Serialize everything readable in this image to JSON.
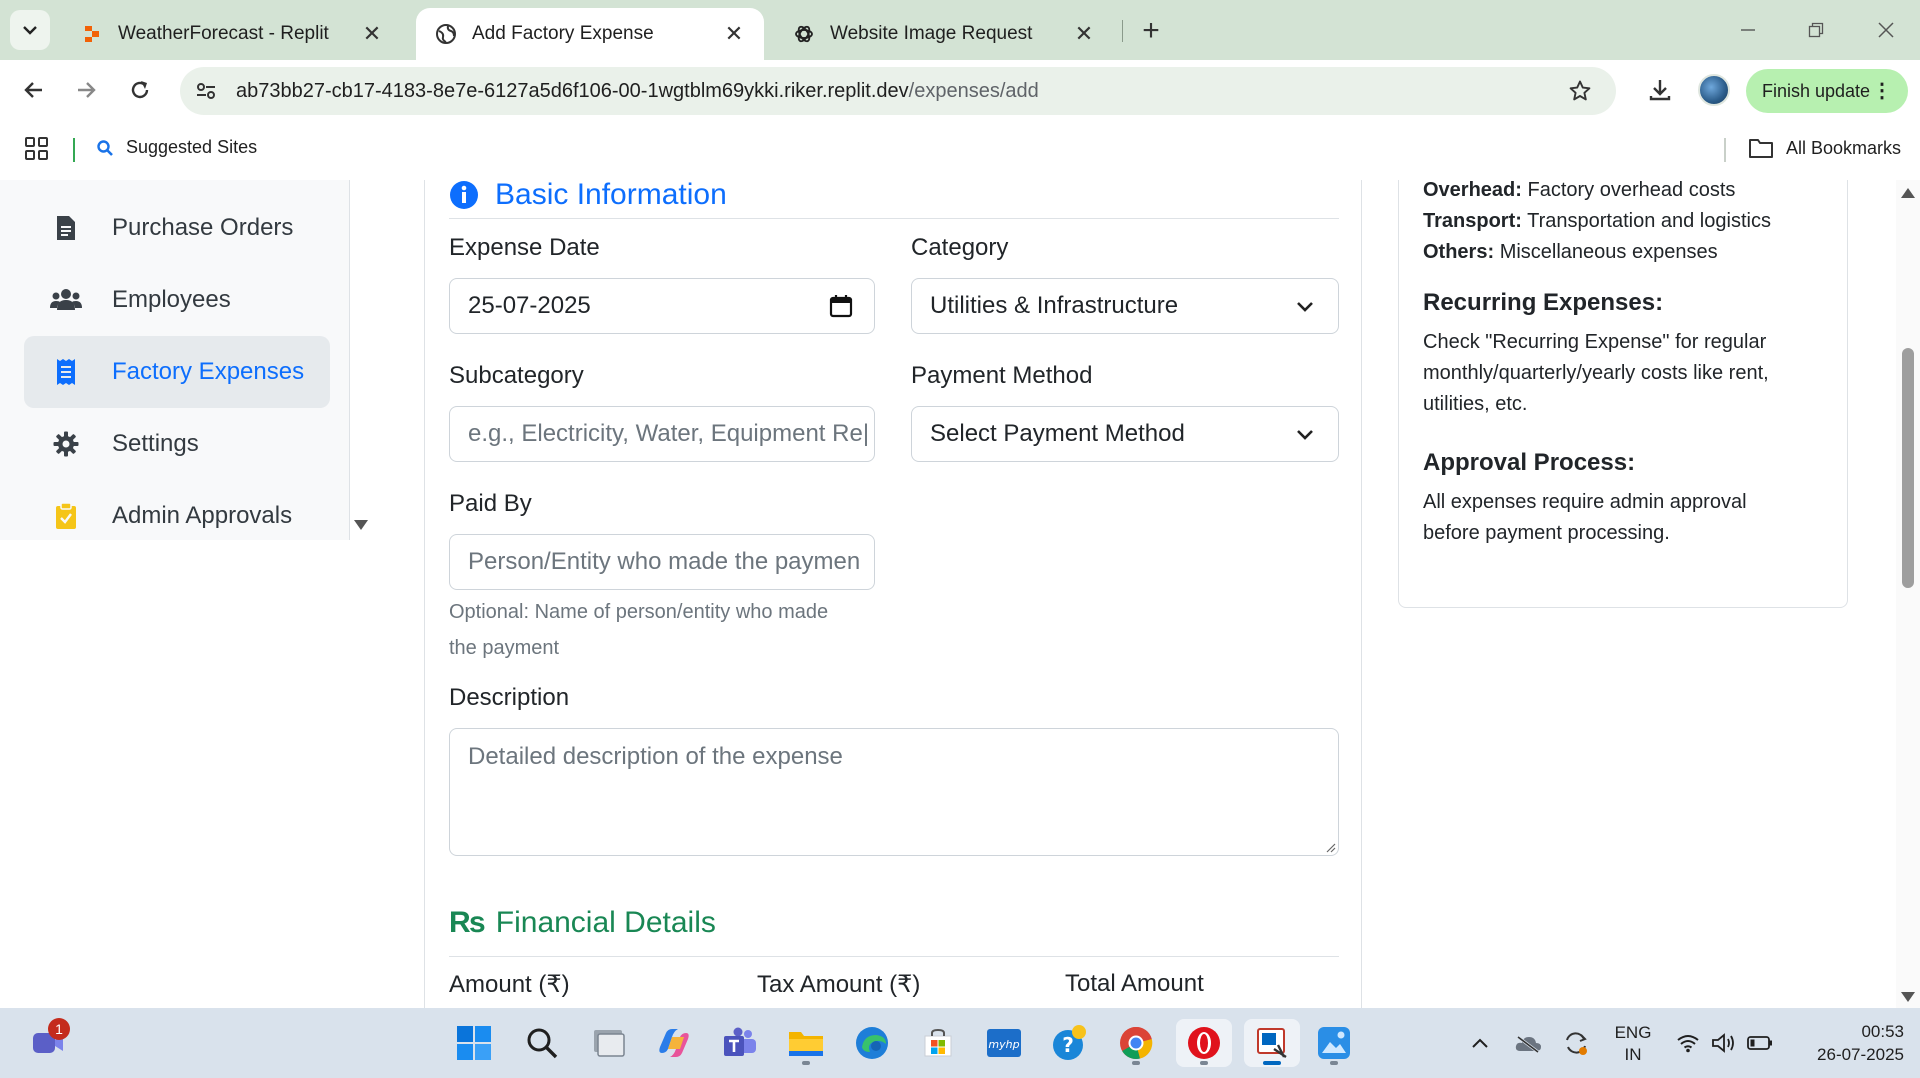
{
  "browser": {
    "tabs": [
      {
        "title": "WeatherForecast - Replit",
        "active": false
      },
      {
        "title": "Add Factory Expense",
        "active": true
      },
      {
        "title": "Website Image Request",
        "active": false
      }
    ],
    "url_host": "ab73bb27-cb17-4183-8e7e-6127a5d6f106-00-1wgtblm69ykki.riker.replit.dev",
    "url_path": "/expenses/add",
    "finish_update_label": "Finish update",
    "bookmarks": {
      "suggested_sites": "Suggested Sites",
      "all_bookmarks": "All Bookmarks"
    }
  },
  "sidebar": {
    "items": [
      {
        "label": "Purchase Orders",
        "icon": "file-icon",
        "active": false
      },
      {
        "label": "Employees",
        "icon": "users-icon",
        "active": false
      },
      {
        "label": "Factory Expenses",
        "icon": "receipt-icon",
        "active": true
      },
      {
        "label": "Settings",
        "icon": "gear-icon",
        "active": false
      },
      {
        "label": "Admin Approvals",
        "icon": "clipboard-check-icon",
        "active": false
      }
    ]
  },
  "form": {
    "basic_section_title": "Basic Information",
    "expense_date": {
      "label": "Expense Date",
      "value": "25-07-2025"
    },
    "category": {
      "label": "Category",
      "value": "Utilities & Infrastructure"
    },
    "subcategory": {
      "label": "Subcategory",
      "placeholder": "e.g., Electricity, Water, Equipment Re|"
    },
    "payment_method": {
      "label": "Payment Method",
      "value": "Select Payment Method"
    },
    "paid_by": {
      "label": "Paid By",
      "placeholder": "Person/Entity who made the paymen",
      "help_line1": "Optional: Name of person/entity who made",
      "help_line2": "the payment"
    },
    "description": {
      "label": "Description",
      "placeholder": "Detailed description of the expense"
    },
    "financial_section_title": "Financial Details",
    "amount_label": "Amount (₹)",
    "tax_amount_label": "Tax Amount (₹)",
    "total_amount_label": "Total Amount"
  },
  "help_panel": {
    "overhead_term": "Overhead:",
    "overhead_desc": "Factory overhead costs",
    "transport_term": "Transport:",
    "transport_desc": "Transportation and logistics",
    "others_term": "Others:",
    "others_desc": "Miscellaneous expenses",
    "recurring_heading": "Recurring Expenses:",
    "recurring_line1": "Check \"Recurring Expense\" for regular",
    "recurring_line2": "monthly/quarterly/yearly costs like rent,",
    "recurring_line3": "utilities, etc.",
    "approval_heading": "Approval Process:",
    "approval_line1": "All expenses require admin approval",
    "approval_line2": "before payment processing."
  },
  "taskbar": {
    "notification_count": "1",
    "lang_line1": "ENG",
    "lang_line2": "IN",
    "time": "00:53",
    "date": "26-07-2025"
  },
  "colors": {
    "primary": "#0d6efd",
    "financial_green": "#198754",
    "tabbar_bg": "#d3e3d4"
  }
}
